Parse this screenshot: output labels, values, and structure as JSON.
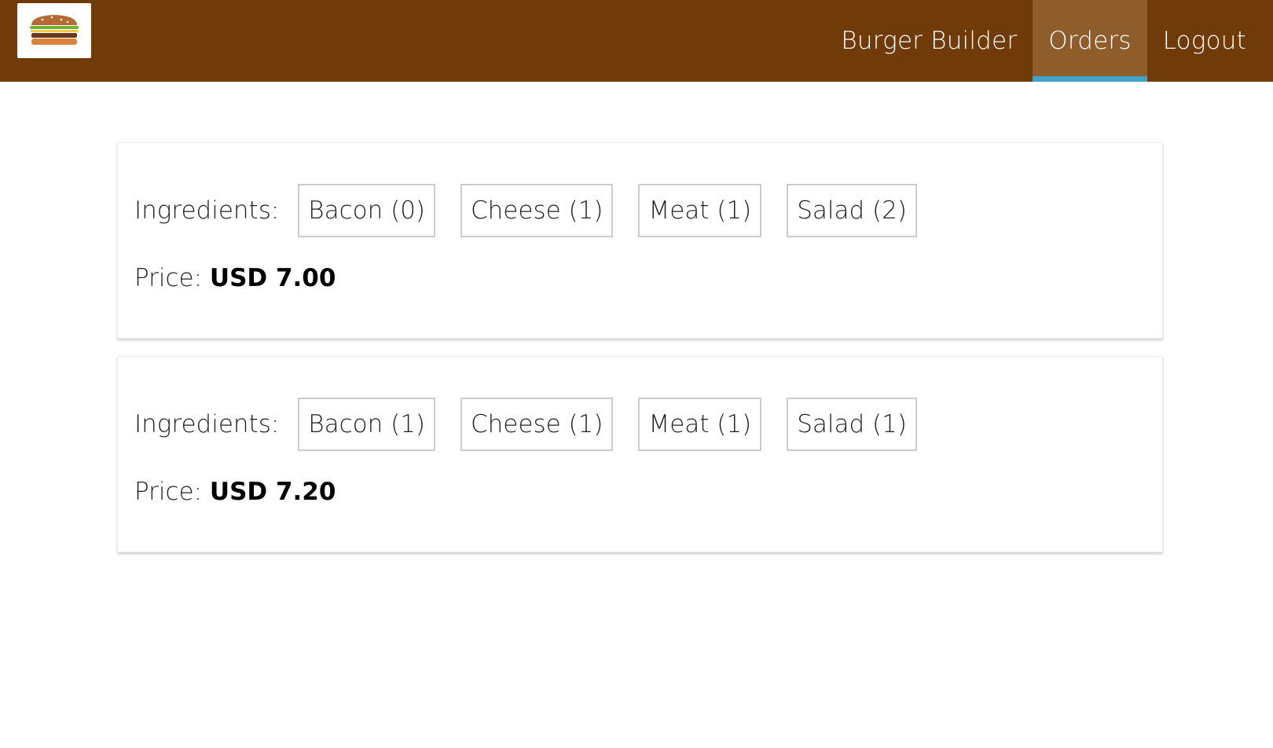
{
  "app": {
    "logo_alt": "burger-logo"
  },
  "nav": {
    "items": [
      {
        "label": "Burger Builder",
        "active": false
      },
      {
        "label": "Orders",
        "active": true
      },
      {
        "label": "Logout",
        "active": false
      }
    ]
  },
  "orders": [
    {
      "ingredients_label": "Ingredients:",
      "ingredients": [
        "Bacon (0)",
        "Cheese (1)",
        "Meat (1)",
        "Salad (2)"
      ],
      "price_label": "Price:",
      "price_value": "USD 7.00"
    },
    {
      "ingredients_label": "Ingredients:",
      "ingredients": [
        "Bacon (1)",
        "Cheese (1)",
        "Meat (1)",
        "Salad (1)"
      ],
      "price_label": "Price:",
      "price_value": "USD 7.20"
    }
  ],
  "colors": {
    "toolbar": "#703b09",
    "active_nav": "#8f5c2c",
    "active_underline": "#40a4c8"
  }
}
